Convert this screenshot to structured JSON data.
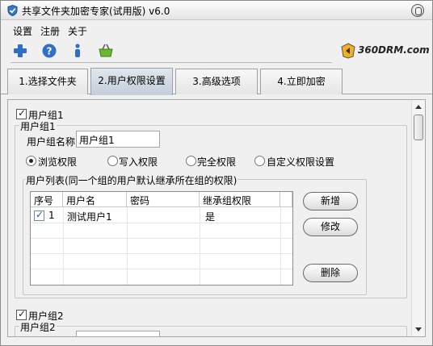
{
  "window": {
    "title": "共享文件夹加密专家(试用版) v6.0"
  },
  "menu": {
    "items": [
      "设置",
      "注册",
      "关于"
    ]
  },
  "toolbar": {
    "buttons": [
      {
        "icon": "add-icon"
      },
      {
        "icon": "help-icon"
      },
      {
        "icon": "info-icon"
      },
      {
        "icon": "basket-icon"
      }
    ],
    "brand": "360DRM.com"
  },
  "tabs": [
    {
      "label": "1.选择文件夹",
      "active": false
    },
    {
      "label": "2.用户权限设置",
      "active": true
    },
    {
      "label": "3.高级选项",
      "active": false
    },
    {
      "label": "4.立即加密",
      "active": false
    }
  ],
  "group1": {
    "checkbox_label": "用户组1",
    "legend": "用户组1",
    "name_label": "用户组名称",
    "name_value": "用户组1",
    "permissions": [
      {
        "label": "浏览权限",
        "selected": true
      },
      {
        "label": "写入权限",
        "selected": false
      },
      {
        "label": "完全权限",
        "selected": false
      },
      {
        "label": "自定义权限设置",
        "selected": false
      }
    ],
    "user_list_legend": "用户列表(同一个组的用户默认继承所在组的权限)",
    "table": {
      "columns": [
        "序号",
        "用户名",
        "密码",
        "继承组权限"
      ],
      "rows": [
        {
          "checked": true,
          "index": "1",
          "username": "测试用户1",
          "password": "",
          "inherit": "是"
        }
      ]
    },
    "buttons": {
      "add": "新增",
      "edit": "修改",
      "delete": "删除"
    }
  },
  "group2": {
    "checkbox_label": "用户组2",
    "legend": "用户组2"
  },
  "colors": {
    "window_bg": "#f0f0f0",
    "active_tab": "#c4ced8",
    "checkbox_blue": "#2a5aa0"
  }
}
